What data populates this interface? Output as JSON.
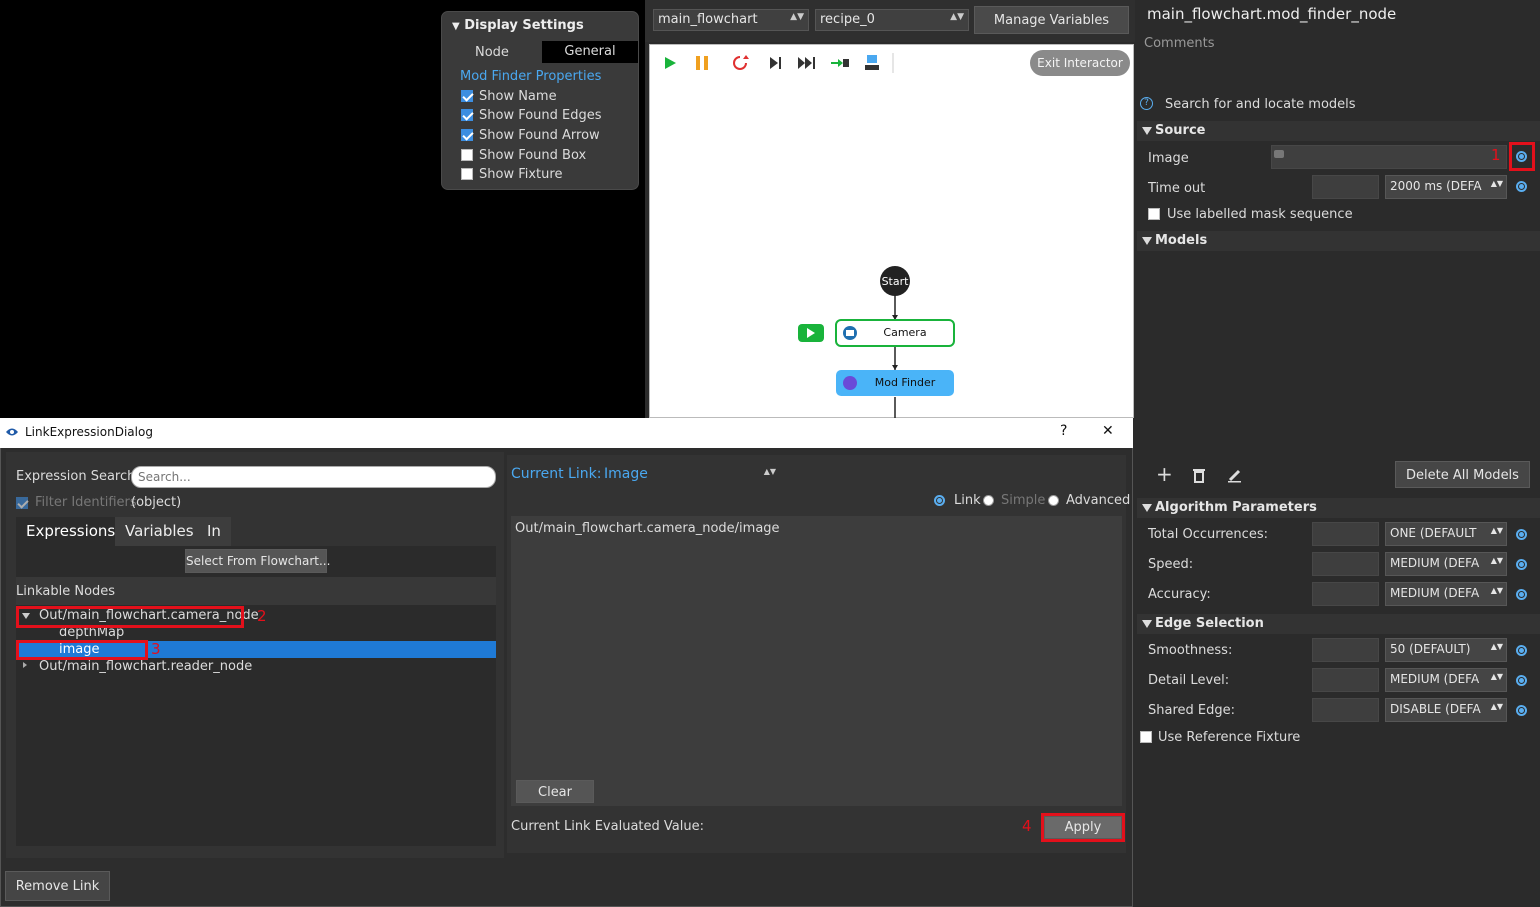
{
  "display_settings": {
    "title": "Display Settings",
    "tab_node": "Node",
    "tab_general": "General",
    "section": "Mod Finder Properties",
    "items": [
      {
        "label": "Show Name",
        "checked": true
      },
      {
        "label": "Show Found Edges",
        "checked": true
      },
      {
        "label": "Show Found Arrow",
        "checked": true
      },
      {
        "label": "Show Found Box",
        "checked": false
      },
      {
        "label": "Show Fixture",
        "checked": false
      }
    ]
  },
  "flowchart": {
    "flowchart_select": "main_flowchart",
    "recipe_select": "recipe_0",
    "manage_variables": "Manage Variables",
    "exit_interactor": "Exit Interactor",
    "nodes": {
      "start": "Start",
      "camera": "Camera",
      "mod_finder": "Mod Finder"
    }
  },
  "right_panel": {
    "title": "main_flowchart.mod_finder_node",
    "comments": "Comments",
    "description": "Search for and locate models",
    "source": {
      "header": "Source",
      "image_label": "Image",
      "timeout_label": "Time out",
      "timeout_value": "2000 ms (DEFA",
      "mask_label": "Use labelled mask sequence"
    },
    "models": {
      "header": "Models",
      "delete_all": "Delete All Models"
    },
    "algorithm": {
      "header": "Algorithm Parameters",
      "rows": [
        {
          "label": "Total Occurrences:",
          "value": "ONE (DEFAULT"
        },
        {
          "label": "Speed:",
          "value": "MEDIUM (DEFA"
        },
        {
          "label": "Accuracy:",
          "value": "MEDIUM (DEFA"
        }
      ]
    },
    "edge": {
      "header": "Edge Selection",
      "rows": [
        {
          "label": "Smoothness:",
          "value": "50 (DEFAULT)"
        },
        {
          "label": "Detail Level:",
          "value": "MEDIUM (DEFA"
        },
        {
          "label": "Shared Edge:",
          "value": "DISABLE (DEFA"
        }
      ],
      "fixture_label": "Use Reference Fixture"
    }
  },
  "dialog": {
    "title": "LinkExpressionDialog",
    "help": "?",
    "close": "✕",
    "search_label": "Expression Search:",
    "search_placeholder": "Search...",
    "filter_label": "Filter Identifiers",
    "filter_type": "(object)",
    "tabs": [
      "Expressions",
      "Variables",
      "In"
    ],
    "select_from_flowchart": "Select From Flowchart...",
    "linkable_nodes": "Linkable Nodes",
    "tree": {
      "camera_node": "Out/main_flowchart.camera_node",
      "depth_map": "depthMap",
      "image": "image",
      "reader_node": "Out/main_flowchart.reader_node"
    },
    "current_link_label": "Current Link:",
    "current_link_value": "Image",
    "modes": [
      "Link",
      "Simple",
      "Advanced"
    ],
    "link_text": "Out/main_flowchart.camera_node/image",
    "clear": "Clear",
    "evaluated_label": "Current Link Evaluated Value:",
    "apply": "Apply",
    "remove_link": "Remove Link"
  },
  "annotations": [
    "1",
    "2",
    "3",
    "4"
  ]
}
